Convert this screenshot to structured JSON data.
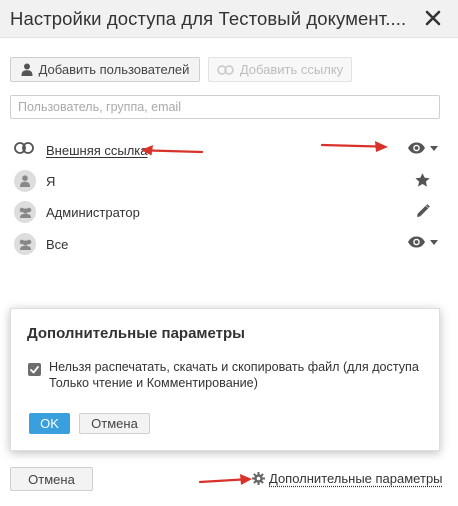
{
  "dialog": {
    "title": "Настройки доступа для Тестовый документ....",
    "close_icon": "close-icon"
  },
  "toolbar": {
    "add_users_label": "Добавить пользователей",
    "add_users_icon": "user-icon",
    "add_link_label": "Добавить ссылку",
    "add_link_icon": "link-icon"
  },
  "search": {
    "placeholder": "Пользователь, группа, email",
    "value": ""
  },
  "access_list": [
    {
      "label": "Внешняя ссылка",
      "icon": "link-icon",
      "right_icon": "eye-icon",
      "has_dropdown": true
    },
    {
      "label": "Я",
      "icon": "user-icon",
      "right_icon": "star-icon",
      "has_dropdown": false
    },
    {
      "label": "Администратор",
      "icon": "users-icon",
      "right_icon": "pencil-icon",
      "has_dropdown": false
    },
    {
      "label": "Все",
      "icon": "users-icon",
      "right_icon": "eye-icon",
      "has_dropdown": true
    }
  ],
  "advanced_panel": {
    "title": "Дополнительные параметры",
    "checkbox_checked": true,
    "checkbox_label": "Нельзя распечатать, скачать и скопировать файл (для доступа Только чтение и Комментирование)",
    "ok_label": "OK",
    "cancel_label": "Отмена"
  },
  "footer": {
    "cancel_label": "Отмена",
    "advanced_link_label": "Дополнительные параметры",
    "advanced_link_icon": "gear-icon"
  },
  "colors": {
    "accent": "#3aa0dd",
    "annotation_arrow": "#d9322b",
    "title_bar": "#f1f1f1"
  }
}
